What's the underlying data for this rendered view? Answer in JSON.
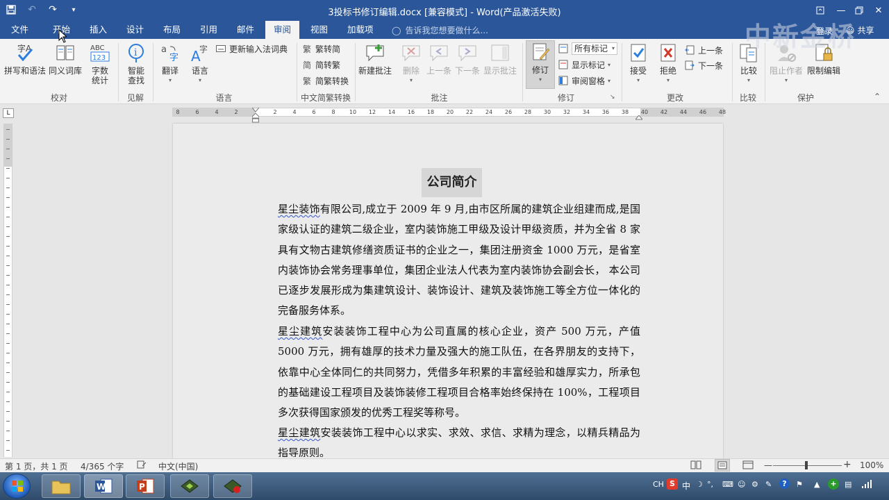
{
  "window": {
    "title": "3投标书修订编辑.docx [兼容模式] - Word(产品激活失败)",
    "login": "登录",
    "share": "共享",
    "watermark": "中新金桥",
    "tellme": "告诉我您想要做什么..."
  },
  "tabs": [
    "文件",
    "开始",
    "插入",
    "设计",
    "布局",
    "引用",
    "邮件",
    "审阅",
    "视图",
    "加载项"
  ],
  "active_tab": "审阅",
  "ribbon": {
    "proofing": {
      "spell": "拼写和语法",
      "thesaurus": "同义词库",
      "wordcount_1": "字数",
      "wordcount_2": "统计",
      "group": "校对"
    },
    "insights": {
      "smart_1": "智能",
      "smart_2": "查找",
      "group": "见解"
    },
    "language": {
      "translate": "翻译",
      "language": "语言",
      "ime": "更新输入法词典",
      "group": "语言"
    },
    "chinese": {
      "t2s": "繁转简",
      "s2t": "简转繁",
      "convert": "简繁转换",
      "group": "中文简繁转换"
    },
    "comments": {
      "new": "新建批注",
      "delete": "删除",
      "prev": "上一条",
      "next": "下一条",
      "show": "显示批注",
      "group": "批注"
    },
    "tracking": {
      "track": "修订",
      "all_markup": "所有标记",
      "show_markup": "显示标记",
      "pane": "审阅窗格",
      "group": "修订"
    },
    "changes": {
      "accept": "接受",
      "reject": "拒绝",
      "prev": "上一条",
      "next": "下一条",
      "group": "更改"
    },
    "compare": {
      "compare": "比较",
      "group": "比较"
    },
    "protect": {
      "block": "阻止作者",
      "restrict": "限制编辑",
      "group": "保护"
    }
  },
  "ruler_numbers": [
    "8",
    "6",
    "4",
    "2",
    "",
    "2",
    "4",
    "6",
    "8",
    "10",
    "12",
    "14",
    "16",
    "18",
    "20",
    "22",
    "24",
    "26",
    "28",
    "30",
    "32",
    "34",
    "36",
    "38",
    "40",
    "42",
    "44",
    "46",
    "48"
  ],
  "document": {
    "title": "公司简介",
    "p1_mark": "星尘装饰",
    "p1_rest": "有限公司,成立于 2009 年 9 月,由市区所属的建筑企业组建而成,是国家级认证的建筑二级企业，室内装饰施工甲级及设计甲级资质，并为全省 8 家具有文物古建筑修缮资质证书的企业之一，集团注册资金 1000 万元，是省室内装饰协会常务理事单位，集团企业法人代表为室内装饰协会副会长， 本公司已逐步发展形成为集建筑设计、装饰设计、建筑及装饰施工等全方位一体化的完备服务体系。",
    "p2_mark": "星尘建筑",
    "p2_rest": "安装装饰工程中心为公司直属的核心企业，资产 500 万元，产值 5000 万元，拥有雄厚的技术力量及强大的施工队伍，在各界朋友的支持下，依靠中心全体同仁的共同努力，凭借多年积累的丰富经验和雄厚实力，所承包的基础建设工程项目及装饰装修工程项目合格率始终保持在 100%，工程项目多次获得国家颁发的优秀工程奖等称号。",
    "p3_mark": "星尘建筑",
    "p3_rest": "安装装饰工程中心以求实、求效、求信、求精为理念，以精兵精品为指导原则。"
  },
  "status": {
    "page": "第 1 页，共 1 页",
    "words": "4/365 个字",
    "lang": "中文(中国)",
    "zoom": "100%"
  },
  "tray": {
    "ime": "CH",
    "ime_cn": "中"
  }
}
